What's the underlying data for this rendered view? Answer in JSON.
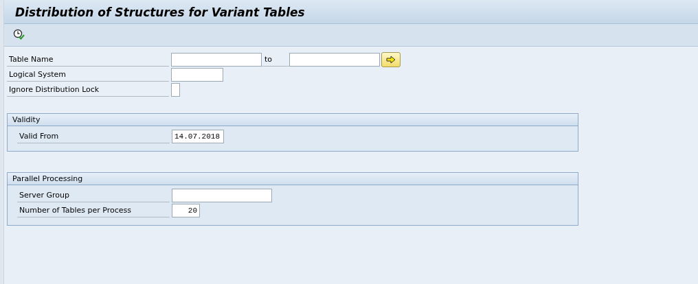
{
  "window": {
    "title": "Distribution of Structures for Variant Tables"
  },
  "fields": [
    {
      "label": "Table Name",
      "kind": "range",
      "to_label": "to"
    },
    {
      "label": "Logical System",
      "kind": "text"
    },
    {
      "label": "Ignore Distribution Lock",
      "kind": "checkbox",
      "checked": false
    }
  ],
  "groups": [
    {
      "title": "Validity",
      "fields": [
        {
          "label": "Valid From",
          "kind": "date",
          "value": "14.07.2018"
        }
      ]
    },
    {
      "title": "Parallel Processing",
      "fields": [
        {
          "label": "Server Group",
          "kind": "longtext"
        },
        {
          "label": "Number of Tables per Process",
          "kind": "number",
          "value": "20"
        }
      ]
    }
  ]
}
